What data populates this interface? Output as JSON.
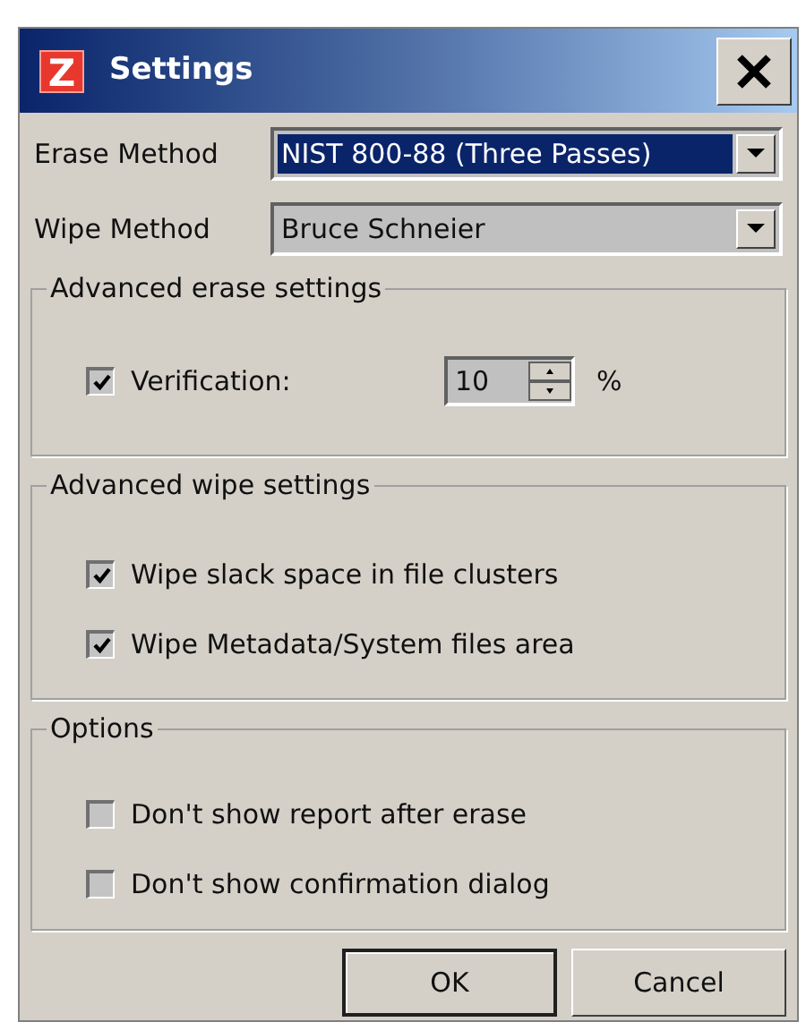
{
  "window": {
    "logo": "Z",
    "title": "Settings"
  },
  "method_rows": [
    {
      "label": "Erase Method",
      "value": "NIST 800-88 (Three Passes)",
      "focused": true
    },
    {
      "label": "Wipe Method",
      "value": "Bruce Schneier",
      "focused": false
    }
  ],
  "erase_group": {
    "title": "Advanced erase settings",
    "verification": {
      "label": "Verification:",
      "checked": true,
      "value": "10",
      "unit": "%"
    }
  },
  "wipe_group": {
    "title": "Advanced wipe settings",
    "items": [
      {
        "label": "Wipe slack space in file clusters",
        "checked": true
      },
      {
        "label": "Wipe Metadata/System files area",
        "checked": true
      }
    ]
  },
  "options_group": {
    "title": "Options",
    "items": [
      {
        "label": "Don't show report after erase",
        "checked": false
      },
      {
        "label": "Don't show confirmation dialog",
        "checked": false
      }
    ]
  },
  "buttons": [
    {
      "label": "OK",
      "default": true
    },
    {
      "label": "Cancel",
      "default": false
    }
  ]
}
